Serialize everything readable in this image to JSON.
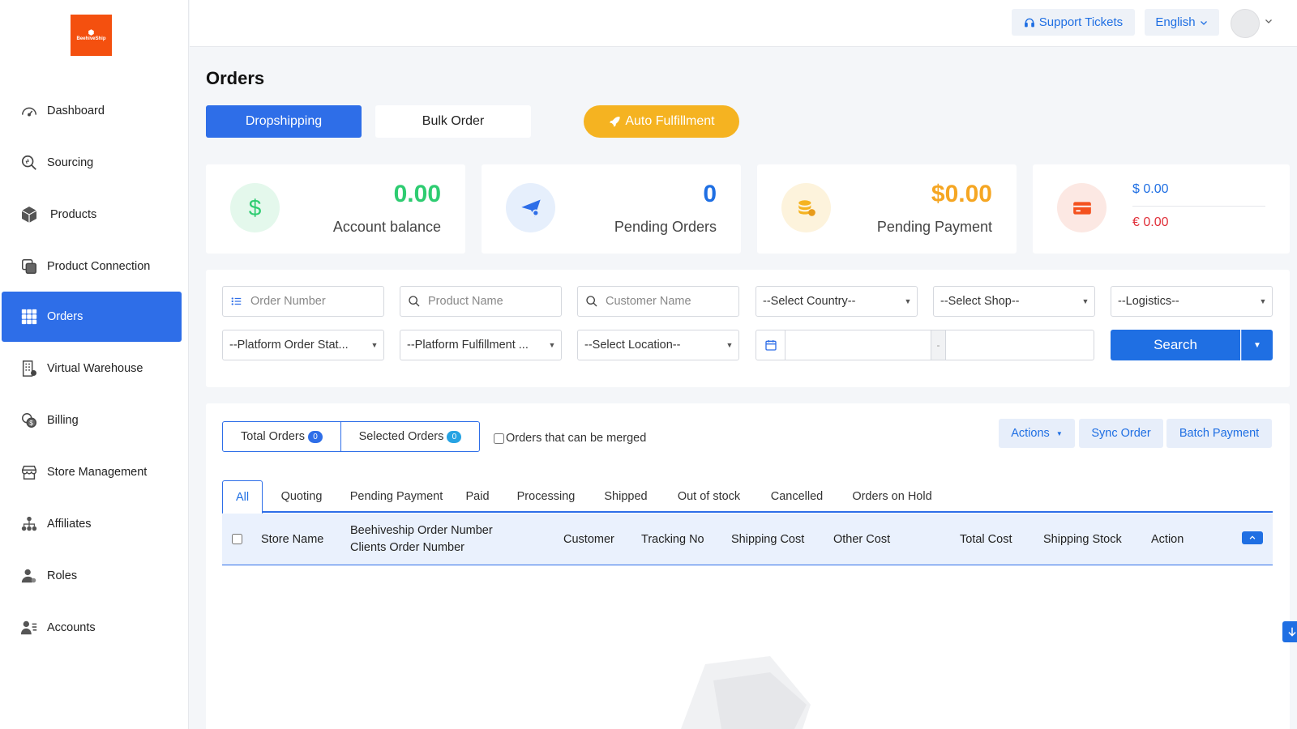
{
  "brand": {
    "logo_text": "BeehiveShip"
  },
  "sidebar": {
    "items": [
      {
        "label": "Dashboard",
        "icon": "dashboard-icon"
      },
      {
        "label": "Sourcing",
        "icon": "sourcing-icon"
      },
      {
        "label": "Products",
        "icon": "products-icon"
      },
      {
        "label": "Product Connection",
        "icon": "product-connection-icon"
      },
      {
        "label": "Orders",
        "icon": "orders-icon",
        "active": true
      },
      {
        "label": "Virtual Warehouse",
        "icon": "warehouse-icon"
      },
      {
        "label": "Billing",
        "icon": "billing-icon"
      },
      {
        "label": "Store Management",
        "icon": "store-icon"
      },
      {
        "label": "Affiliates",
        "icon": "affiliates-icon"
      },
      {
        "label": "Roles",
        "icon": "roles-icon"
      },
      {
        "label": "Accounts",
        "icon": "accounts-icon"
      }
    ]
  },
  "header": {
    "support_label": "Support Tickets",
    "language_label": "English"
  },
  "page": {
    "title": "Orders",
    "modes": {
      "dropshipping": "Dropshipping",
      "bulk": "Bulk Order",
      "auto": "Auto Fulfillment"
    }
  },
  "stats": {
    "balance": {
      "value": "0.00",
      "label": "Account balance"
    },
    "pending_orders": {
      "value": "0",
      "label": "Pending Orders"
    },
    "pending_payment": {
      "value": "$0.00",
      "label": "Pending Payment"
    },
    "wallet": {
      "usd": "$ 0.00",
      "eur": "€ 0.00"
    }
  },
  "filters": {
    "order_number_placeholder": "Order Number",
    "product_name_placeholder": "Product Name",
    "customer_name_placeholder": "Customer Name",
    "country": "--Select Country--",
    "shop": "--Select Shop--",
    "logistics": "--Logistics--",
    "platform_status": "--Platform Order Stat...",
    "platform_fulfillment": "--Platform Fulfillment ...",
    "location": "--Select Location--",
    "date_separator": "-",
    "search_label": "Search"
  },
  "orders": {
    "total_label": "Total Orders",
    "total_count": "0",
    "selected_label": "Selected Orders",
    "selected_count": "0",
    "merge_label": "Orders that can be merged",
    "actions_label": "Actions",
    "sync_label": "Sync Order",
    "batch_label": "Batch Payment",
    "tabs": [
      "All",
      "Quoting",
      "Pending Payment",
      "Paid",
      "Processing",
      "Shipped",
      "Out of stock",
      "Cancelled",
      "Orders on Hold"
    ],
    "columns": {
      "store_name": "Store Name",
      "order_number": "Beehiveship Order Number",
      "client_order_number": "Clients Order Number",
      "customer": "Customer",
      "tracking": "Tracking No",
      "shipping_cost": "Shipping Cost",
      "other_cost": "Other Cost",
      "total_cost": "Total Cost",
      "shipping_stock": "Shipping Stock",
      "action": "Action"
    }
  },
  "colors": {
    "primary": "#2e6ee8",
    "accent_yellow": "#f5b321",
    "balance_green": "#2ecc71",
    "pending_blue": "#1f6fe3",
    "payment_orange": "#f5a623",
    "eur_red": "#e0303a"
  }
}
